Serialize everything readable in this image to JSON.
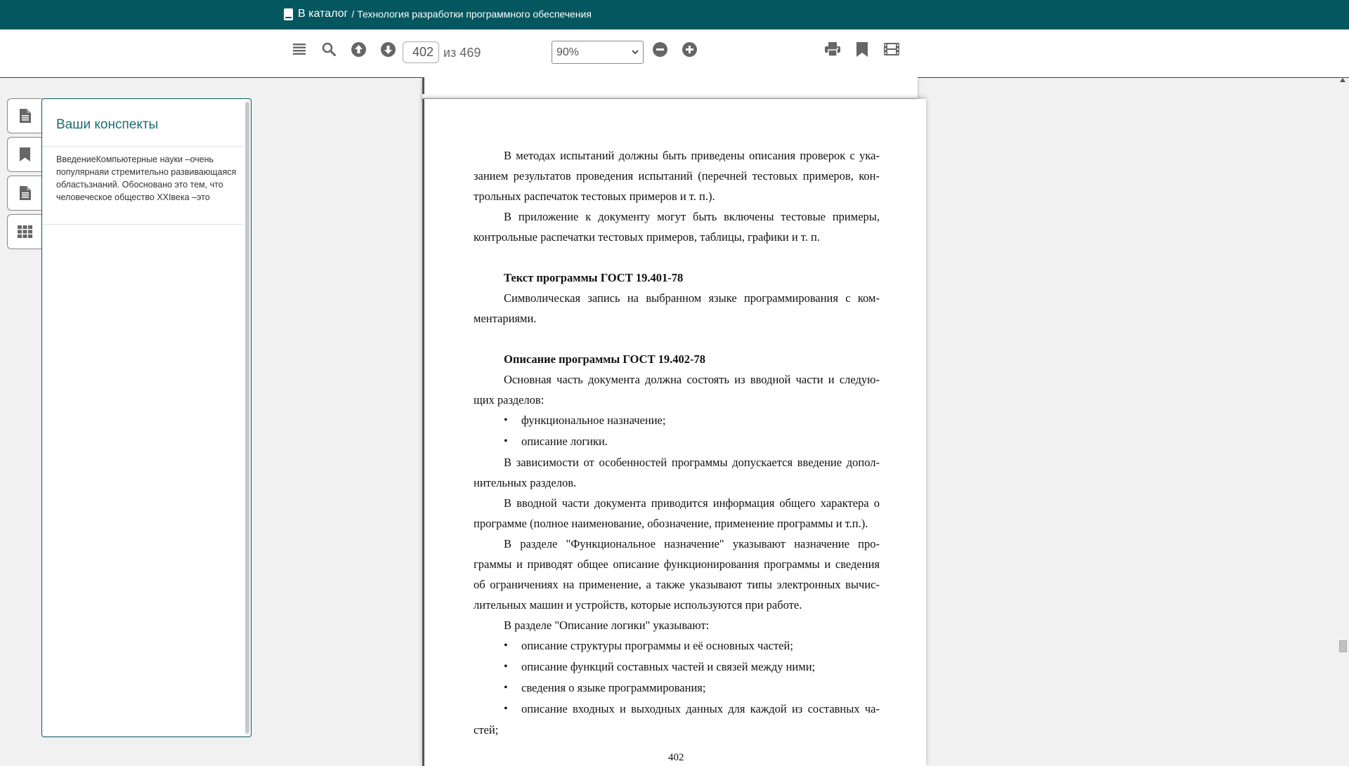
{
  "header": {
    "catalog_link": "В каталог",
    "separator": "/",
    "book_title": "Технология разработки программного обеспечения",
    "bg_color": "#04575f"
  },
  "toolbar": {
    "icons": [
      "toc-icon",
      "search-icon",
      "arrow-up-circle-icon",
      "arrow-down-circle-icon",
      "zoom-out-icon",
      "zoom-in-icon",
      "print-icon",
      "bookmark-icon",
      "filmstrip-icon"
    ],
    "current_page": "402",
    "page_total_label": "из 469",
    "zoom_value": "90%"
  },
  "side_tabs": [
    "document-icon",
    "bookmark-icon",
    "notes-document-icon",
    "grid-icon"
  ],
  "notes": {
    "title": "Ваши конспекты",
    "items": [
      "ВведениеКомпьютерные науки –очень популярнаяи стремительно развивающаяся областьзнаний. Обосновано это тем, что человеческое общество XXIвека –это"
    ]
  },
  "document": {
    "p1": "В методах испытаний должны быть приведены описания проверок с ука-занием результатов проведения испытаний (перечней тестовых примеров, кон-трольных распечаток тестовых примеров и т. п.).",
    "p2": "В приложение к документу могут быть включены тестовые примеры, контрольные распечатки тестовых примеров, таблицы, графики и т. п.",
    "h1": "Текст программы ГОСТ 19.401-78",
    "p3": "Символическая запись на выбранном языке программирования с ком-ментариями.",
    "h2": "Описание программы ГОСТ 19.402-78",
    "p4": "Основная часть документа должна состоять из вводной части и следую-щих разделов:",
    "list1": [
      "функциональное назначение;",
      "описание логики."
    ],
    "p5": "В зависимости от особенностей программы допускается введение допол-нительных разделов.",
    "p6": "В вводной части документа приводится информация общего характера о программе (полное наименование, обозначение, применение программы и т.п.).",
    "p7": "В разделе \"Функциональное назначение\" указывают назначение про-граммы и приводят общее описание функционирования программы и сведения об ограничениях на применение, а также указывают типы электронных вычис-лительных машин и устройств, которые используются при работе.",
    "p8": "В разделе \"Описание логики\" указывают:",
    "list2": [
      "описание структуры программы и её основных частей;",
      "описание функций составных частей и связей между ними;",
      "сведения о языке программирования;",
      "описание входных и выходных данных для каждой из составных ча-стей;"
    ],
    "page_number": "402"
  }
}
